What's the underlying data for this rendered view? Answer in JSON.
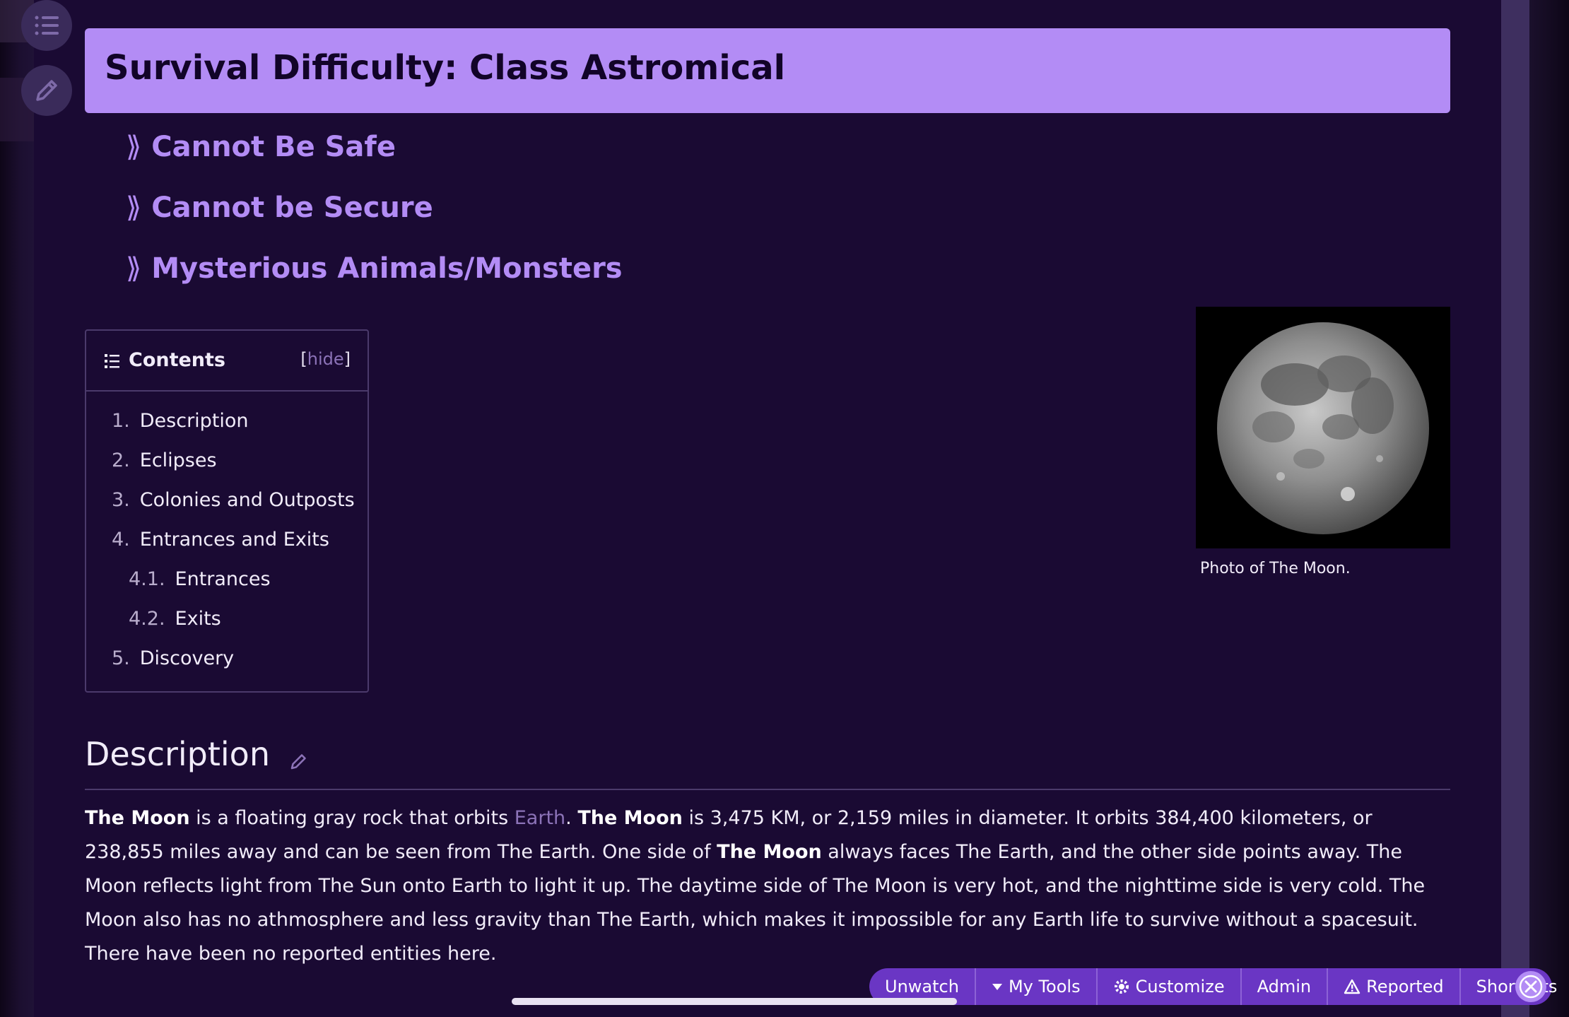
{
  "page": {
    "title": "Survival Difficulty: Class Astromical"
  },
  "tags": [
    {
      "label": "Cannot Be Safe"
    },
    {
      "label": "Cannot be Secure"
    },
    {
      "label": "Mysterious Animals/Monsters"
    }
  ],
  "toc": {
    "title": "Contents",
    "hide_open": "[",
    "hide_label": "hide",
    "hide_close": "]",
    "items": [
      {
        "num": "1.",
        "label": "Description"
      },
      {
        "num": "2.",
        "label": "Eclipses"
      },
      {
        "num": "3.",
        "label": "Colonies and Outposts"
      },
      {
        "num": "4.",
        "label": "Entrances and Exits"
      },
      {
        "num": "4.1.",
        "label": "Entrances"
      },
      {
        "num": "4.2.",
        "label": "Exits"
      },
      {
        "num": "5.",
        "label": "Discovery"
      }
    ]
  },
  "figure": {
    "caption": "Photo of The Moon."
  },
  "description": {
    "heading": "Description",
    "t1": "The Moon",
    "t2": " is a floating gray rock that orbits ",
    "link": "Earth",
    "t3": ". ",
    "t4": "The Moon",
    "t5": " is 3,475 KM, or 2,159 miles in diameter. It orbits 384,400 kilometers, or 238,855 miles away and can be seen from The Earth. One side of ",
    "t6": "The Moon",
    "t7": " always faces The Earth, and the other side points away. The Moon reflects light from The Sun onto Earth to light it up. The daytime side of The Moon is very hot, and the nighttime side is very cold. The Moon also has no athmosphere and less gravity than The Earth, which makes it impossible for any Earth life to survive without a spacesuit. There have been no reported entities here."
  },
  "toolbar": {
    "unwatch": "Unwatch",
    "my_tools": "My Tools",
    "customize": "Customize",
    "admin": "Admin",
    "reported": "Reported",
    "shortcuts": "Shortcuts"
  },
  "colors": {
    "background": "#1a0a33",
    "accent": "#b38cf5",
    "toolbar": "#6a36c4",
    "link": "#8c73b8"
  },
  "icons": [
    "list-icon",
    "pencil-icon",
    "chevron-double-right-icon",
    "caret-down-icon",
    "gear-icon",
    "warning-icon",
    "close-icon"
  ]
}
